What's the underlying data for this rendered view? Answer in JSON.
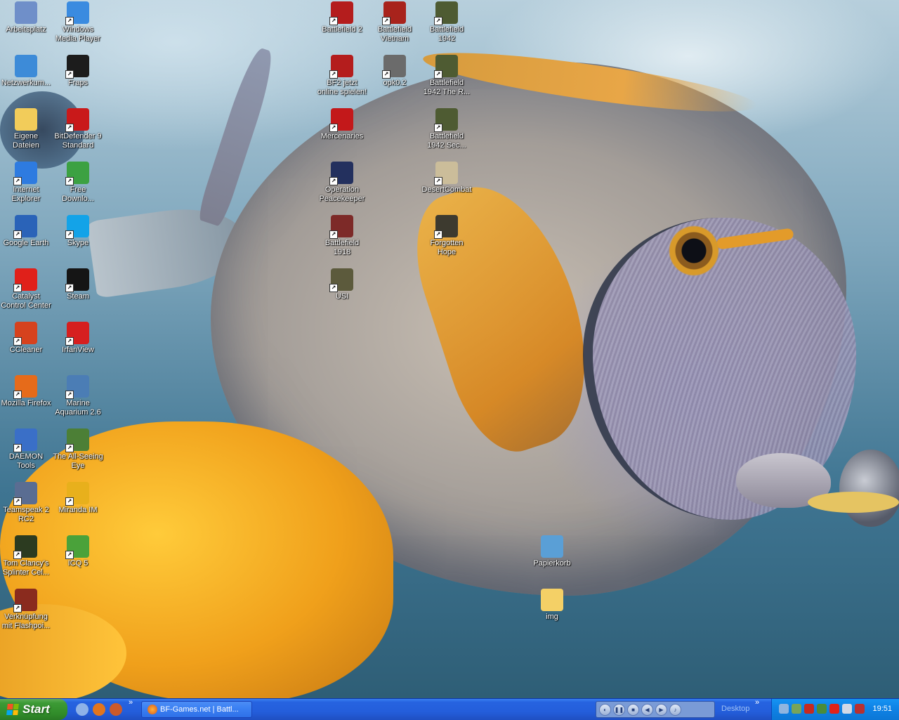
{
  "desktop": {
    "icons_left": [
      {
        "label": "Arbeitsplatz",
        "icon": "my-computer-icon",
        "color": "#6f8fc9"
      },
      {
        "label": "Netzwerkum...",
        "icon": "network-places-icon",
        "color": "#3d8bd8"
      },
      {
        "label": "Eigene\nDateien",
        "icon": "my-documents-icon",
        "color": "#f2cc5a"
      },
      {
        "label": "Internet\nExplorer",
        "icon": "internet-explorer-icon",
        "color": "#2e7be0"
      },
      {
        "label": "Google Earth",
        "icon": "google-earth-icon",
        "color": "#2a63b8"
      },
      {
        "label": "Catalyst\nControl Center",
        "icon": "ati-catalyst-icon",
        "color": "#e0201a"
      },
      {
        "label": "CCleaner",
        "icon": "ccleaner-icon",
        "color": "#d6421e"
      },
      {
        "label": "Mozilla Firefox",
        "icon": "firefox-icon",
        "color": "#e66b1a"
      },
      {
        "label": "DAEMON Tools",
        "icon": "daemon-tools-icon",
        "color": "#3a6fc7"
      },
      {
        "label": "Teamspeak 2\nRC2",
        "icon": "teamspeak-icon",
        "color": "#5a6d92"
      },
      {
        "label": "Tom Clancy's\nSplinter Cel...",
        "icon": "splinter-cell-icon",
        "color": "#2c3b20"
      },
      {
        "label": "Verknüpfung\nmit Flashpoi...",
        "icon": "flashpoint-icon",
        "color": "#8a2b1e"
      }
    ],
    "icons_col2": [
      {
        "label": "Windows\nMedia Player",
        "icon": "media-player-icon",
        "color": "#3a8be0"
      },
      {
        "label": "Fraps",
        "icon": "fraps-icon",
        "color": "#1c1c1c"
      },
      {
        "label": "BitDefender 9\nStandard",
        "icon": "bitdefender-icon",
        "color": "#c9191a"
      },
      {
        "label": "Free\nDownlo...",
        "icon": "free-download-manager-icon",
        "color": "#3ca142"
      },
      {
        "label": "Skype",
        "icon": "skype-icon",
        "color": "#13a3e8"
      },
      {
        "label": "Steam",
        "icon": "steam-icon",
        "color": "#151515"
      },
      {
        "label": "IrfanView",
        "icon": "irfanview-icon",
        "color": "#d61f1f"
      },
      {
        "label": "Marine\nAquarium 2.6",
        "icon": "marine-aquarium-icon",
        "color": "#4b7db5"
      },
      {
        "label": "The All-Seeing\nEye",
        "icon": "all-seeing-eye-icon",
        "color": "#4c7f36"
      },
      {
        "label": "Miranda IM",
        "icon": "miranda-icon",
        "color": "#e8b01c"
      },
      {
        "label": "ICQ 5",
        "icon": "icq-icon",
        "color": "#4aa23a"
      }
    ],
    "icons_col3": [
      {
        "label": "Battlefield 2",
        "icon": "battlefield2-icon",
        "color": "#b41d1d"
      },
      {
        "label": "BF2 jetzt\nonline spielen!",
        "icon": "bf2-online-icon",
        "color": "#b41d1d"
      },
      {
        "label": "Mercenaries",
        "icon": "mercenaries-icon",
        "color": "#c3181a"
      },
      {
        "label": "Operation\nPeacekeeper",
        "icon": "operation-peacekeeper-icon",
        "color": "#23305e"
      },
      {
        "label": "Battlefield\n1918",
        "icon": "battlefield-1918-icon",
        "color": "#7d2a28"
      },
      {
        "label": "USI",
        "icon": "usi-icon",
        "color": "#5c5a3c"
      }
    ],
    "icons_col4": [
      {
        "label": "Battlefield\nVietnam",
        "icon": "battlefield-vietnam-icon",
        "color": "#a8231c"
      },
      {
        "label": "opk0.2",
        "icon": "opk-icon",
        "color": "#6b6b6b"
      },
      {
        "label": "",
        "icon": "",
        "color": ""
      }
    ],
    "icons_col5": [
      {
        "label": "Battlefield\n1942",
        "icon": "battlefield-1942-icon",
        "color": "#4e5b32"
      },
      {
        "label": "Battlefield\n1942 The R...",
        "icon": "bf1942-road-to-rome-icon",
        "color": "#4e5b32"
      },
      {
        "label": "Battlefield\n1942 Sec...",
        "icon": "bf1942-secret-weapons-icon",
        "color": "#4e5b32"
      },
      {
        "label": "DesertCombat",
        "icon": "desertcombat-icon",
        "color": "#cbbd9a"
      },
      {
        "label": "Forgotten\nHope",
        "icon": "forgotten-hope-icon",
        "color": "#3d3a2f"
      }
    ],
    "icons_other": [
      {
        "label": "Papierkorb",
        "icon": "recycle-bin-icon",
        "color": "#5a9fd6"
      },
      {
        "label": "img",
        "icon": "folder-icon",
        "color": "#f4d066"
      }
    ]
  },
  "taskbar": {
    "start_label": "Start",
    "quick_launch": [
      {
        "icon": "show-desktop-icon",
        "color": "#8eb2e8"
      },
      {
        "icon": "firefox-quicklaunch-icon",
        "color": "#e2751d"
      },
      {
        "icon": "media-quicklaunch-icon",
        "color": "#cc5a2b"
      }
    ],
    "window_button": "BF-Games.net | Battl...",
    "desktop_toolbar": "Desktop",
    "clock": "19:51",
    "tray_icons": [
      {
        "icon": "network-tray-icon",
        "color": "#8fb5df"
      },
      {
        "icon": "aquarium-tray-icon",
        "color": "#78a45a"
      },
      {
        "icon": "bitdefender-tray-icon",
        "color": "#c62a1f"
      },
      {
        "icon": "antivirus-tray-icon",
        "color": "#4a8c3a"
      },
      {
        "icon": "ati-tray-icon",
        "color": "#e02218"
      },
      {
        "icon": "volume-tray-icon",
        "color": "#d2d9e6"
      },
      {
        "icon": "security-tray-icon",
        "color": "#b83030"
      }
    ]
  }
}
